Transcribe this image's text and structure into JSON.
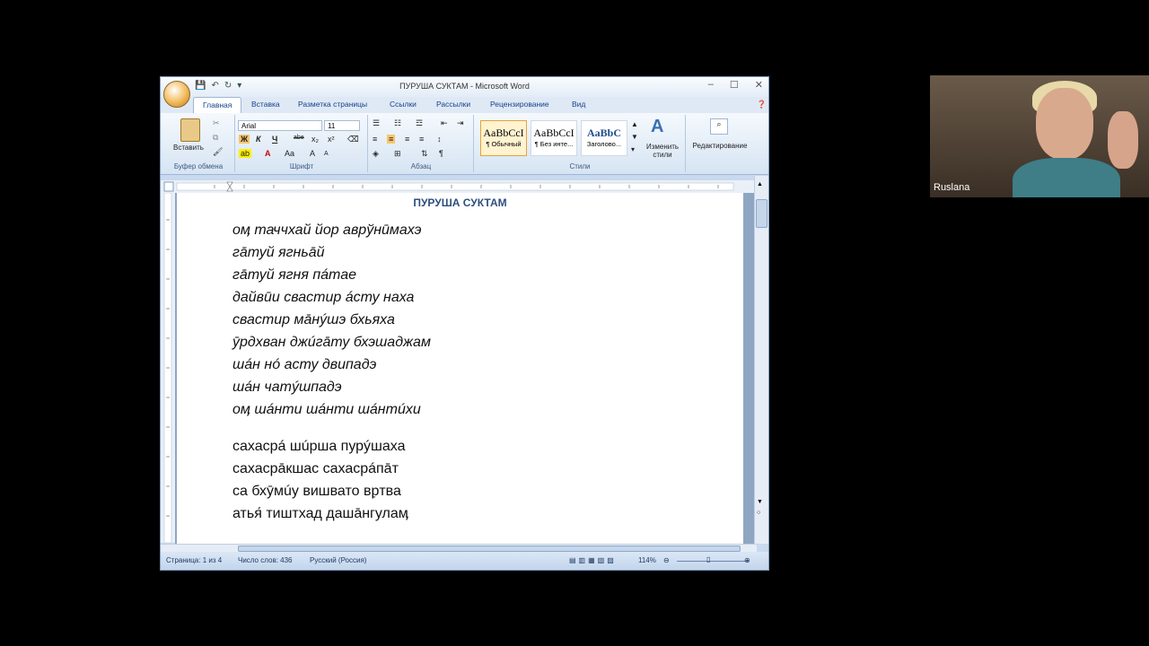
{
  "window": {
    "title": "ПУРУША СУКТАМ - Microsoft Word",
    "controls": [
      "–",
      "☐",
      "✕"
    ]
  },
  "tabs": [
    "Главная",
    "Вставка",
    "Разметка страницы",
    "Ссылки",
    "Рассылки",
    "Рецензирование",
    "Вид"
  ],
  "ribbon": {
    "clipboard": {
      "label": "Буфер обмена",
      "paste": "Вставить"
    },
    "font": {
      "label": "Шрифт",
      "name": "Arial",
      "size": "11"
    },
    "paragraph": {
      "label": "Абзац"
    },
    "styles": {
      "label": "Стили",
      "items": [
        {
          "preview": "AaBbCcI",
          "name": "¶ Обычный"
        },
        {
          "preview": "AaBbCcI",
          "name": "¶ Без инте..."
        },
        {
          "preview": "AaBbC",
          "name": "Заголово..."
        }
      ],
      "change": "Изменить стили"
    },
    "editing": {
      "label": "Редактирование"
    }
  },
  "document": {
    "title": "ПУРУША СУКТАМ",
    "stanza1": [
      "оӎ таччхай йор аврўнӣмахэ",
      "гāтуй ягньāй",
      "гāтуй ягня пáтае",
      "дайвӣи сваcтир áсту наха",
      "сваcтир мāнýшэ бхьяха",
      "ӯрдхван джúгāту бхэшаджам",
      "шáн нó асту двипадэ",
      "шáн чатýшпадэ",
      "оӎ шáнти шáнти шáнтúхи"
    ],
    "stanza2": [
      "сахасрá шúрша пурýшаха",
      "сахасрāкшас сахасрáпāт",
      "са бхӯмúу вишвато вр̣тва",
      "атья́ тиштхад дашāнгулаӎ"
    ]
  },
  "status": {
    "page": "Страница: 1 из 4",
    "words": "Число слов: 436",
    "language": "Русский (Россия)",
    "zoom": "114%"
  },
  "webcam": {
    "name": "Ruslana"
  }
}
